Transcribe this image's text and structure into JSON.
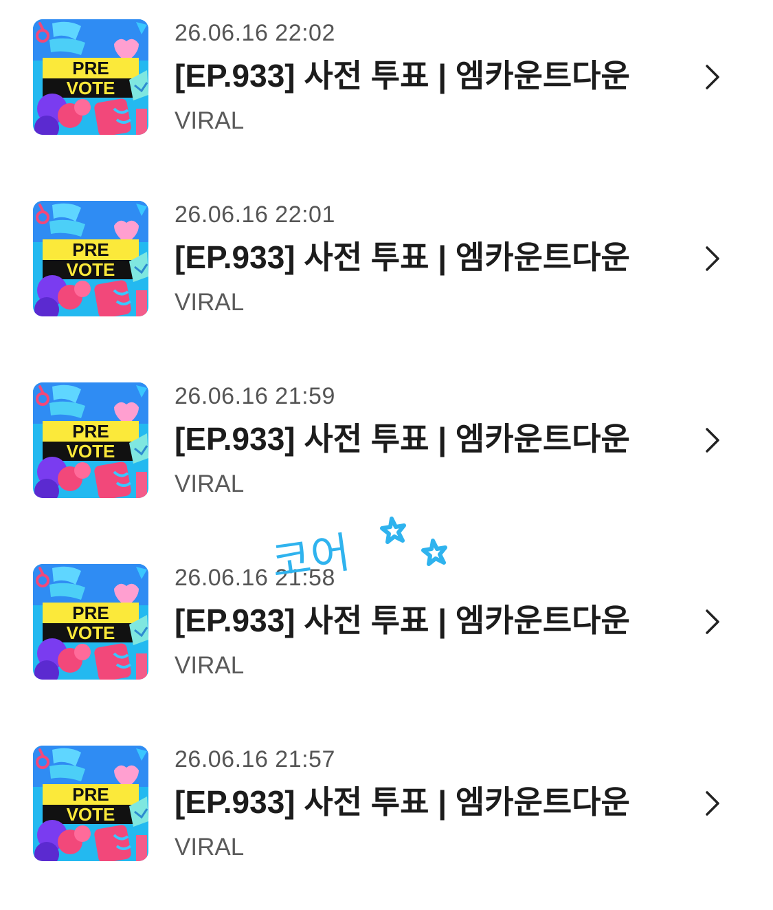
{
  "items": [
    {
      "date": "26.06.16 22:02",
      "title": "[EP.933] 사전 투표 | 엠카운트다운",
      "source": "VIRAL",
      "thumb": {
        "line1": "PRE",
        "line2": "VOTE"
      }
    },
    {
      "date": "26.06.16 22:01",
      "title": "[EP.933] 사전 투표 | 엠카운트다운",
      "source": "VIRAL",
      "thumb": {
        "line1": "PRE",
        "line2": "VOTE"
      }
    },
    {
      "date": "26.06.16 21:59",
      "title": "[EP.933] 사전 투표 | 엠카운트다운",
      "source": "VIRAL",
      "thumb": {
        "line1": "PRE",
        "line2": "VOTE"
      }
    },
    {
      "date": "26.06.16 21:58",
      "title": "[EP.933] 사전 투표 | 엠카운트다운",
      "source": "VIRAL",
      "thumb": {
        "line1": "PRE",
        "line2": "VOTE"
      }
    },
    {
      "date": "26.06.16 21:57",
      "title": "[EP.933] 사전 투표 | 엠카운트다운",
      "source": "VIRAL",
      "thumb": {
        "line1": "PRE",
        "line2": "VOTE"
      }
    }
  ],
  "doodle": {
    "text": "코어",
    "color": "#2fb3ee"
  },
  "icons": {
    "chevron": "chevron-right-icon"
  },
  "colors": {
    "thumb_bg": "#23b9f0",
    "thumb_banner": "#fbe93a",
    "thumb_band": "#111111",
    "accent_pink": "#f2487a",
    "accent_purple": "#7a3cf0"
  }
}
